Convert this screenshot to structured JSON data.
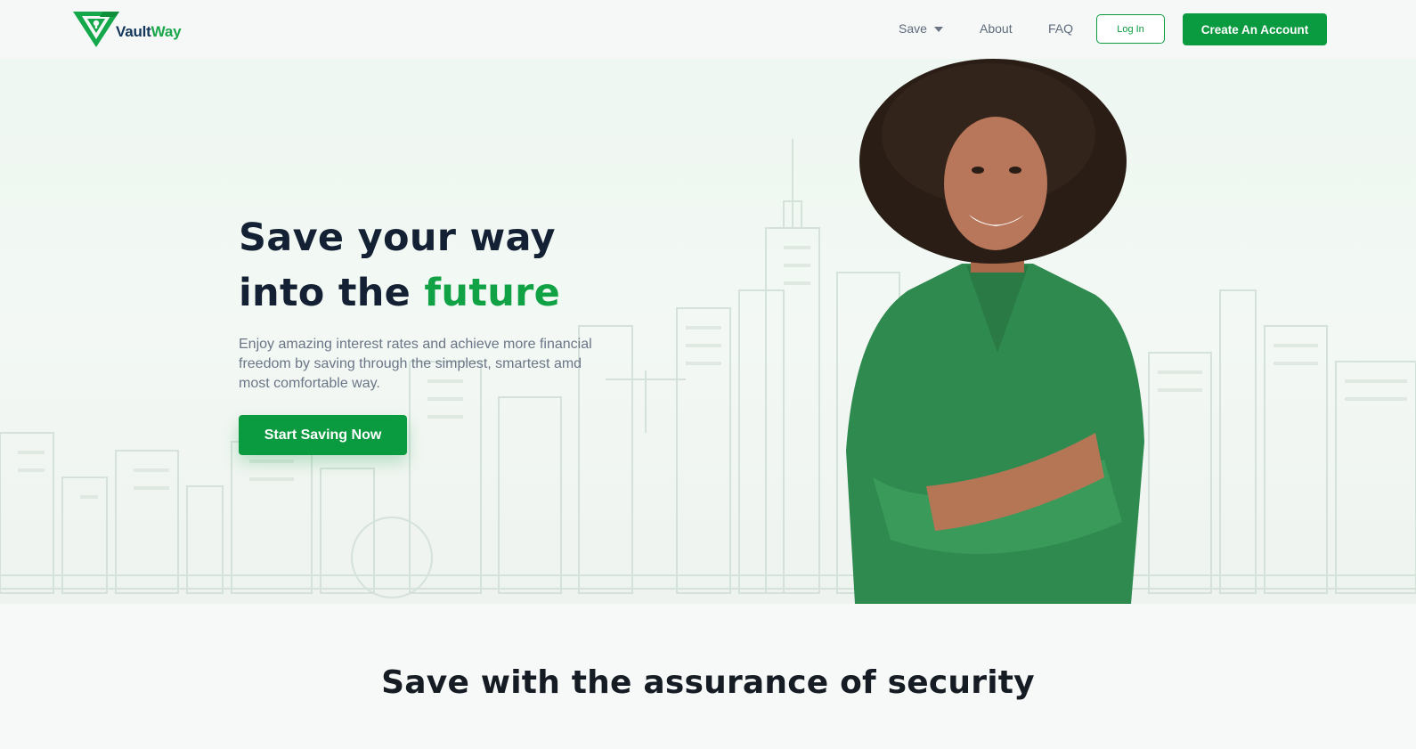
{
  "brand": {
    "name_part1": "Vault",
    "name_part2": "Way",
    "colors": {
      "primary": "#0a9a3f",
      "accent_text": "#12a246",
      "navy": "#14365a",
      "heading": "#142033"
    }
  },
  "nav": {
    "items": [
      {
        "label": "Save",
        "icon": "chevron-down-icon"
      },
      {
        "label": "About"
      },
      {
        "label": "FAQ"
      }
    ],
    "login_label": "Log In",
    "create_account_label": "Create An Account"
  },
  "hero": {
    "title_line1": "Save your way",
    "title_line2_prefix": "into the ",
    "title_line2_accent": "future",
    "subtitle": "Enjoy amazing interest rates and achieve more financial freedom by saving through the simplest, smartest amd most comfortable way.",
    "cta_label": "Start Saving Now"
  },
  "security_section": {
    "title": "Save with the assurance of security"
  }
}
